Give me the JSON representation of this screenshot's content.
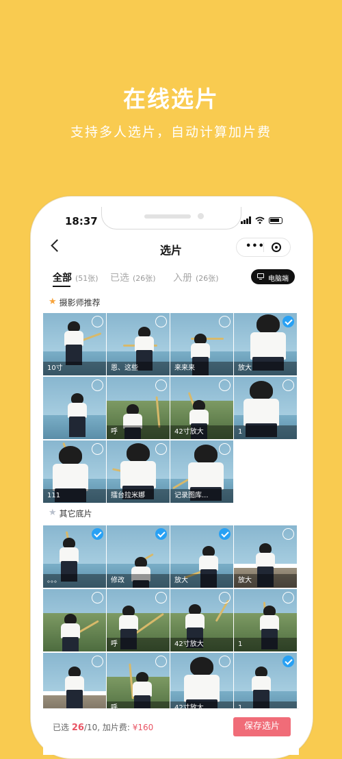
{
  "promo": {
    "title": "在线选片",
    "subtitle": "支持多人选片，自动计算加片费"
  },
  "status_bar": {
    "time": "18:37"
  },
  "nav": {
    "title": "选片",
    "capsule_menu": "•••"
  },
  "tabs": [
    {
      "label": "全部",
      "count": "(51张)"
    },
    {
      "label": "已选",
      "count": "(26张)"
    },
    {
      "label": "入册",
      "count": "(26张)"
    }
  ],
  "pc_button": {
    "label": "电脑端",
    "icon": "monitor-icon"
  },
  "sections": {
    "recommended": {
      "title": "摄影师推荐",
      "icon": "star-icon",
      "icon_color": "#F7A33B"
    },
    "others": {
      "title": "其它底片",
      "icon": "star-icon",
      "icon_color": "#B9C0CC"
    }
  },
  "recommended_photos": [
    {
      "caption": "10寸",
      "selected": false
    },
    {
      "caption": "恩、这些",
      "selected": false
    },
    {
      "caption": "来来来",
      "selected": false
    },
    {
      "caption": "放大",
      "selected": true
    },
    {
      "caption": "",
      "selected": false
    },
    {
      "caption": "呼",
      "selected": false
    },
    {
      "caption": "42寸放大",
      "selected": false
    },
    {
      "caption": "1",
      "selected": false
    },
    {
      "caption": "111",
      "selected": false
    },
    {
      "caption": "擂台拉米娜",
      "selected": false
    },
    {
      "caption": "记录图库...",
      "selected": false
    }
  ],
  "other_photos": [
    {
      "caption": "。。。",
      "selected": true
    },
    {
      "caption": "修改",
      "selected": true
    },
    {
      "caption": "放大",
      "selected": true
    },
    {
      "caption": "放大",
      "selected": false
    },
    {
      "caption": "",
      "selected": false
    },
    {
      "caption": "呼",
      "selected": false
    },
    {
      "caption": "42寸放大",
      "selected": false
    },
    {
      "caption": "1",
      "selected": false
    },
    {
      "caption": "",
      "selected": false
    },
    {
      "caption": "呼",
      "selected": false
    },
    {
      "caption": "42寸放大",
      "selected": false
    },
    {
      "caption": "1",
      "selected": true
    }
  ],
  "summary": {
    "selected_label": "已选",
    "selected_count": "26",
    "limit": "/10,",
    "fee_label": "加片费:",
    "fee": "¥160"
  },
  "save_button": {
    "label": "保存选片"
  },
  "colors": {
    "background": "#F9CB50",
    "check_on": "#28A1F4",
    "save_button": "#F06C78",
    "accent_text": "#E95464"
  }
}
